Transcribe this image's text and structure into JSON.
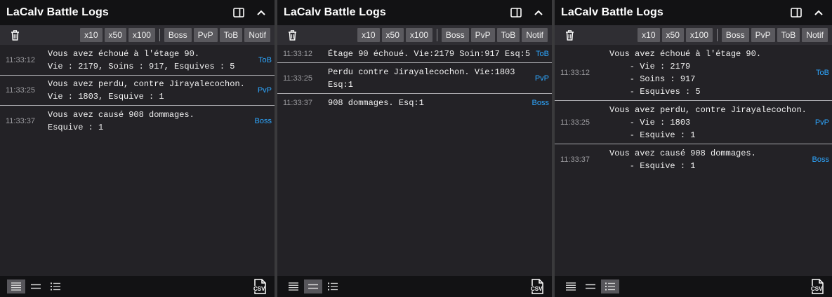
{
  "panels": [
    {
      "title": "LaCalv Battle Logs",
      "toolbar": [
        "x10",
        "x50",
        "x100",
        "Boss",
        "PvP",
        "ToB",
        "Notif"
      ],
      "view": "full",
      "rows": [
        {
          "time": "11:33:12",
          "text": "Vous avez échoué à l'étage 90.\nVie : 2179, Soins : 917, Esquives : 5",
          "tag": "ToB"
        },
        {
          "time": "11:33:25",
          "text": "Vous avez perdu, contre Jirayalecochon.\nVie : 1803, Esquive : 1",
          "tag": "PvP"
        },
        {
          "time": "11:33:37",
          "text": "Vous avez causé 908 dommages.\nEsquive : 1",
          "tag": "Boss"
        }
      ]
    },
    {
      "title": "LaCalv Battle Logs",
      "toolbar": [
        "x10",
        "x50",
        "x100",
        "Boss",
        "PvP",
        "ToB",
        "Notif"
      ],
      "view": "compact",
      "rows": [
        {
          "time": "11:33:12",
          "text": "Étage 90 échoué. Vie:2179 Soin:917 Esq:5",
          "tag": "ToB"
        },
        {
          "time": "11:33:25",
          "text": "Perdu contre Jirayalecochon. Vie:1803\nEsq:1",
          "tag": "PvP"
        },
        {
          "time": "11:33:37",
          "text": "908 dommages. Esq:1",
          "tag": "Boss"
        }
      ]
    },
    {
      "title": "LaCalv Battle Logs",
      "toolbar": [
        "x10",
        "x50",
        "x100",
        "Boss",
        "PvP",
        "ToB",
        "Notif"
      ],
      "view": "list",
      "rows": [
        {
          "time": "11:33:12",
          "text": "Vous avez échoué à l'étage 90.\n    - Vie : 2179\n    - Soins : 917\n    - Esquives : 5",
          "tag": "ToB"
        },
        {
          "time": "11:33:25",
          "text": "Vous avez perdu, contre Jirayalecochon.\n    - Vie : 1803\n    - Esquive : 1",
          "tag": "PvP"
        },
        {
          "time": "11:33:37",
          "text": "Vous avez causé 908 dommages.\n    - Esquive : 1",
          "tag": "Boss"
        }
      ]
    }
  ],
  "icons": {
    "trash": "trash-icon",
    "layout": "panel-toggle-icon",
    "collapse": "chevron-up-icon",
    "full": "view-full-icon",
    "compact": "view-compact-icon",
    "list": "view-list-icon",
    "csv": "csv-export-icon"
  },
  "colors": {
    "tag": "#2ea7ff",
    "button": "#5a595e",
    "header": "#121214",
    "background": "#232226"
  }
}
